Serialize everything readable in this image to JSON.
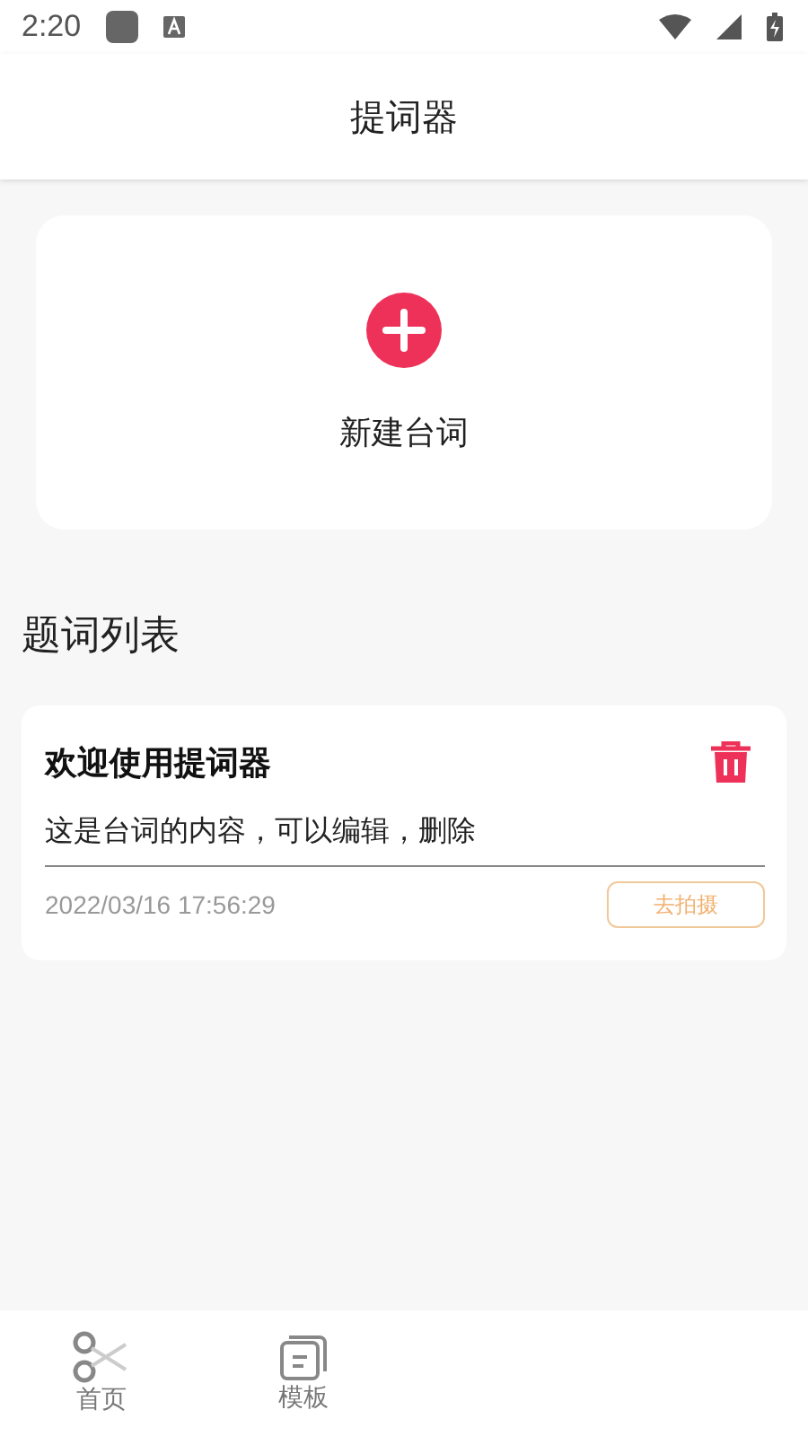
{
  "status_bar": {
    "time": "2:20"
  },
  "header": {
    "title": "提词器"
  },
  "new_card": {
    "label": "新建台词"
  },
  "section_title": "题词列表",
  "scripts": [
    {
      "title": "欢迎使用提词器",
      "content": "这是台词的内容，可以编辑，删除",
      "time": "2022/03/16 17:56:29",
      "action": "去拍摄"
    }
  ],
  "nav": [
    {
      "label": "首页",
      "kind": "scissors"
    },
    {
      "label": "模板",
      "kind": "stack"
    }
  ]
}
